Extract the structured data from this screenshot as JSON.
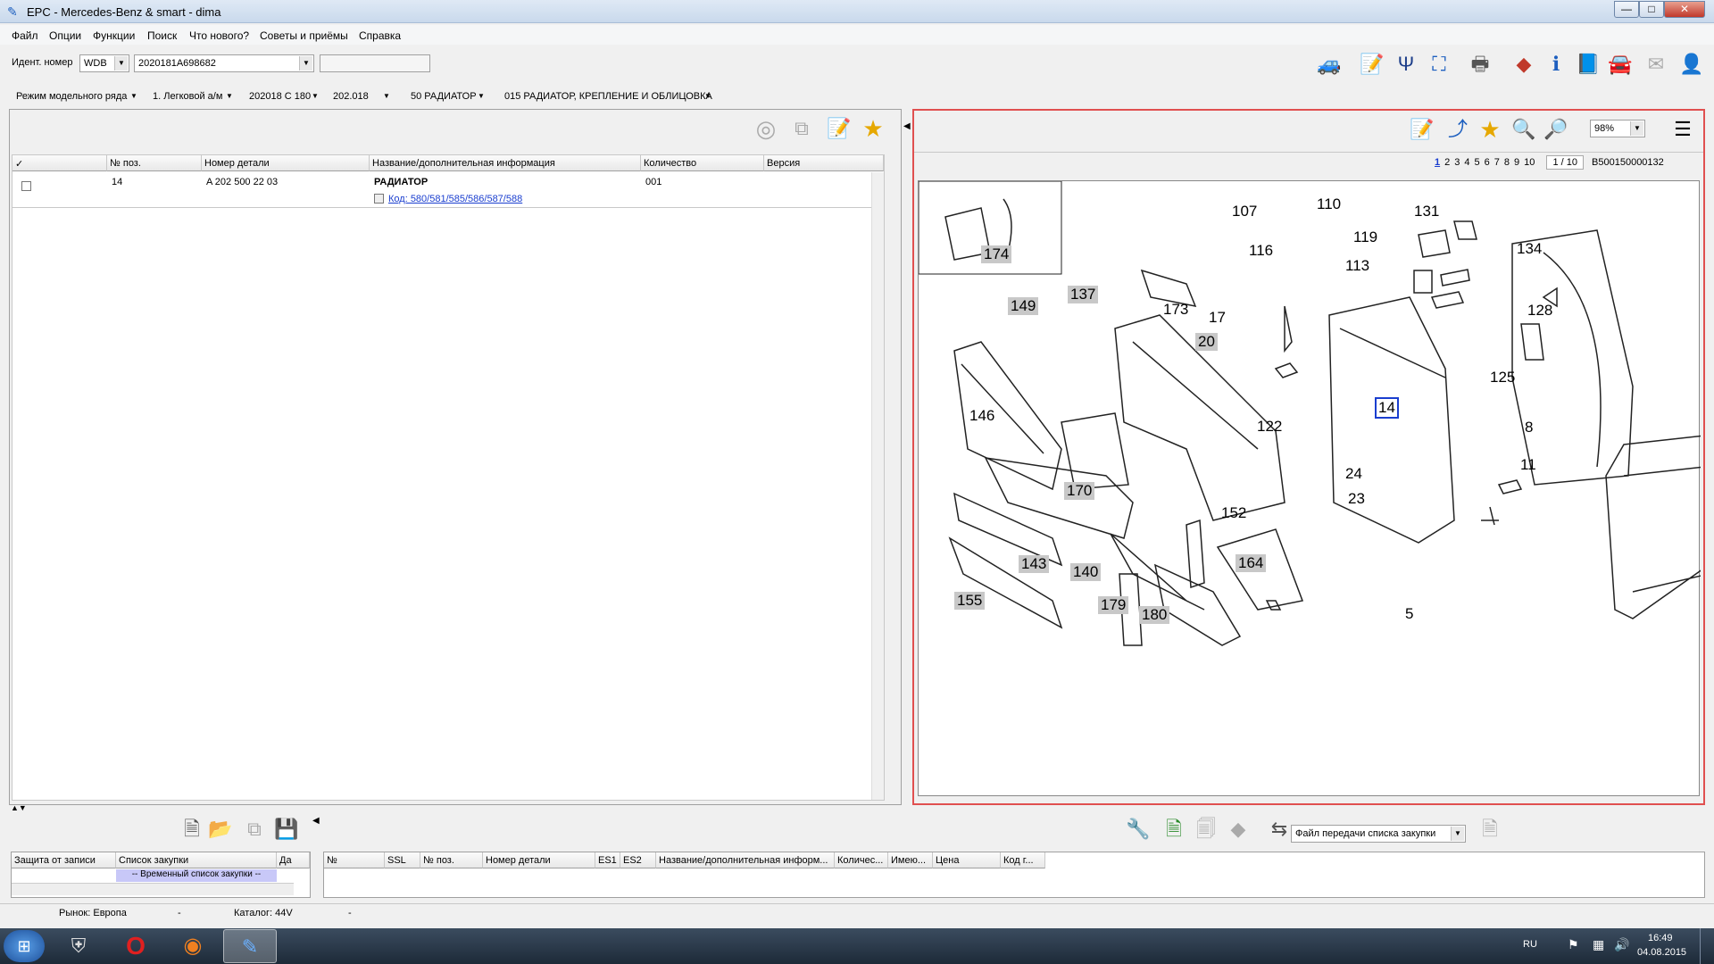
{
  "window": {
    "title": "EPC - Mercedes-Benz & smart - dima",
    "min": "—",
    "max": "□",
    "close": "✕"
  },
  "menu": [
    "Файл",
    "Опции",
    "Функции",
    "Поиск",
    "Что нового?",
    "Советы и приёмы",
    "Справка"
  ],
  "ident": {
    "label": "Идент. номер",
    "prefix": "WDB",
    "vin": "2020181A698682",
    "extra": ""
  },
  "breadcrumb": [
    "Режим модельного ряда",
    "1. Легковой а/м",
    "202018 С 180",
    "202.018",
    "50 РАДИАТОР",
    "015 РАДИАТОР, КРЕПЛЕНИЕ И ОБЛИЦОВКА"
  ],
  "grid": {
    "headers": [
      "✓",
      "№ поз.",
      "Номер детали",
      "Название/дополнительная информация",
      "Количество",
      "Версия"
    ],
    "rows": [
      {
        "pos": "14",
        "part": "A 202 500 22 03",
        "name": "РАДИАТОР",
        "qty": "001",
        "code": "Код: 580/581/585/586/587/588"
      }
    ]
  },
  "viewer": {
    "zoom": "98%",
    "pages": [
      "1",
      "2",
      "3",
      "4",
      "5",
      "6",
      "7",
      "8",
      "9",
      "10"
    ],
    "page_of": "1 / 10",
    "image_id": "B500150000132"
  },
  "diagram_labels": {
    "plain": [
      "107",
      "110",
      "131",
      "119",
      "116",
      "113",
      "134",
      "173",
      "17",
      "128",
      "146",
      "125",
      "122",
      "8",
      "24",
      "11",
      "23",
      "152",
      "5"
    ],
    "boxed": [
      "174",
      "149",
      "137",
      "20",
      "170",
      "143",
      "140",
      "164",
      "155",
      "179",
      "180"
    ],
    "highlight": "14"
  },
  "bottom": {
    "list_headers": [
      "Защита от записи",
      "Список закупки",
      "Да"
    ],
    "list_row": "-- Временный список закупки --",
    "transfer_label": "Файл передачи списка закупки",
    "cart_headers": [
      "№",
      "SSL",
      "№ поз.",
      "Номер детали",
      "ES1",
      "ES2",
      "Название/дополнительная информ...",
      "Количес...",
      "Имею...",
      "Цена",
      "Код г..."
    ]
  },
  "status": {
    "market": "Рынок: Европа",
    "dash1": "-",
    "catalog": "Каталог: 44V",
    "dash2": "-"
  },
  "taskbar": {
    "lang": "RU",
    "time": "16:49",
    "date": "04.08.2015"
  }
}
